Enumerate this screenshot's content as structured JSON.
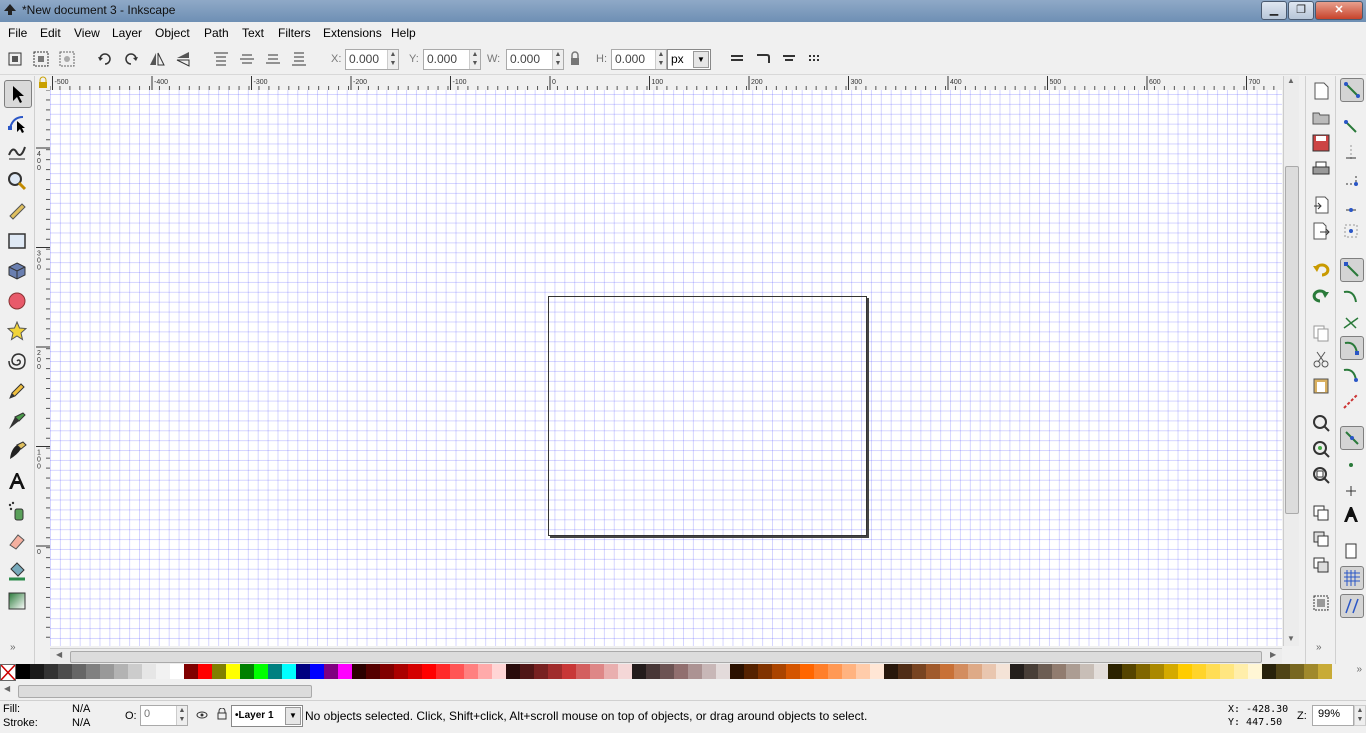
{
  "window": {
    "title": "*New document 3 - Inkscape",
    "min_label": "▁",
    "max_label": "❐",
    "close_label": "✕"
  },
  "menu": [
    "File",
    "Edit",
    "View",
    "Layer",
    "Object",
    "Path",
    "Text",
    "Filters",
    "Extensions",
    "Help"
  ],
  "selector_toolbar": {
    "x_label": "X:",
    "x_value": "0.000",
    "y_label": "Y:",
    "y_value": "0.000",
    "w_label": "W:",
    "w_value": "0.000",
    "h_label": "H:",
    "h_value": "0.000",
    "unit": "px"
  },
  "ruler": {
    "h_ticks": [
      "-500",
      "-400",
      "-300",
      "-200",
      "-100",
      "0",
      "100",
      "200",
      "300",
      "400",
      "500",
      "600",
      "700"
    ],
    "v_ticks": [
      "400",
      "300",
      "200",
      "100",
      "0"
    ]
  },
  "palette": [
    "#000000",
    "#1a1a1a",
    "#333333",
    "#4d4d4d",
    "#666666",
    "#808080",
    "#999999",
    "#b3b3b3",
    "#cccccc",
    "#e6e6e6",
    "#f2f2f2",
    "#ffffff",
    "#800000",
    "#ff0000",
    "#808000",
    "#ffff00",
    "#008000",
    "#00ff00",
    "#008080",
    "#00ffff",
    "#000080",
    "#0000ff",
    "#800080",
    "#ff00ff",
    "#2b0000",
    "#550000",
    "#800000",
    "#aa0000",
    "#d40000",
    "#ff0000",
    "#ff2a2a",
    "#ff5555",
    "#ff8080",
    "#ffaaaa",
    "#ffd5d5",
    "#280b0b",
    "#501616",
    "#782121",
    "#a02c2c",
    "#c83737",
    "#d35f5f",
    "#de8787",
    "#e9afaf",
    "#f4d7d7",
    "#241c1c",
    "#483737",
    "#6c5353",
    "#916f6f",
    "#ac9393",
    "#c8b7b7",
    "#e3dbdb",
    "#2b1100",
    "#552200",
    "#803300",
    "#aa4400",
    "#d45500",
    "#ff6600",
    "#ff7f2a",
    "#ff9955",
    "#ffb380",
    "#ffccaa",
    "#ffe6d5",
    "#28170b",
    "#502d16",
    "#784421",
    "#a05a2c",
    "#c87137",
    "#d38d5f",
    "#deaa87",
    "#e9c6af",
    "#f4e3d7",
    "#241f1c",
    "#483e37",
    "#6c5d53",
    "#917c6f",
    "#ac9d93",
    "#c8beb7",
    "#e3dedb",
    "#2b2200",
    "#554400",
    "#806600",
    "#aa8800",
    "#d4aa00",
    "#ffcc00",
    "#ffd42a",
    "#ffdd55",
    "#ffe680",
    "#ffeeaa",
    "#fff6d5",
    "#28220b",
    "#504416",
    "#786721",
    "#a0892c",
    "#c8ab37"
  ],
  "status": {
    "fill_label": "Fill:",
    "fill_value": "N/A",
    "stroke_label": "Stroke:",
    "stroke_value": "N/A",
    "opacity_label": "O:",
    "opacity_value": "0",
    "layer": "•Layer 1",
    "message": "No objects selected. Click, Shift+click, Alt+scroll mouse on top of objects, or drag around objects to select.",
    "x_coord": "X: -428.30",
    "y_coord": "Y:  447.50",
    "zoom_label": "Z:",
    "zoom_value": "99%"
  }
}
